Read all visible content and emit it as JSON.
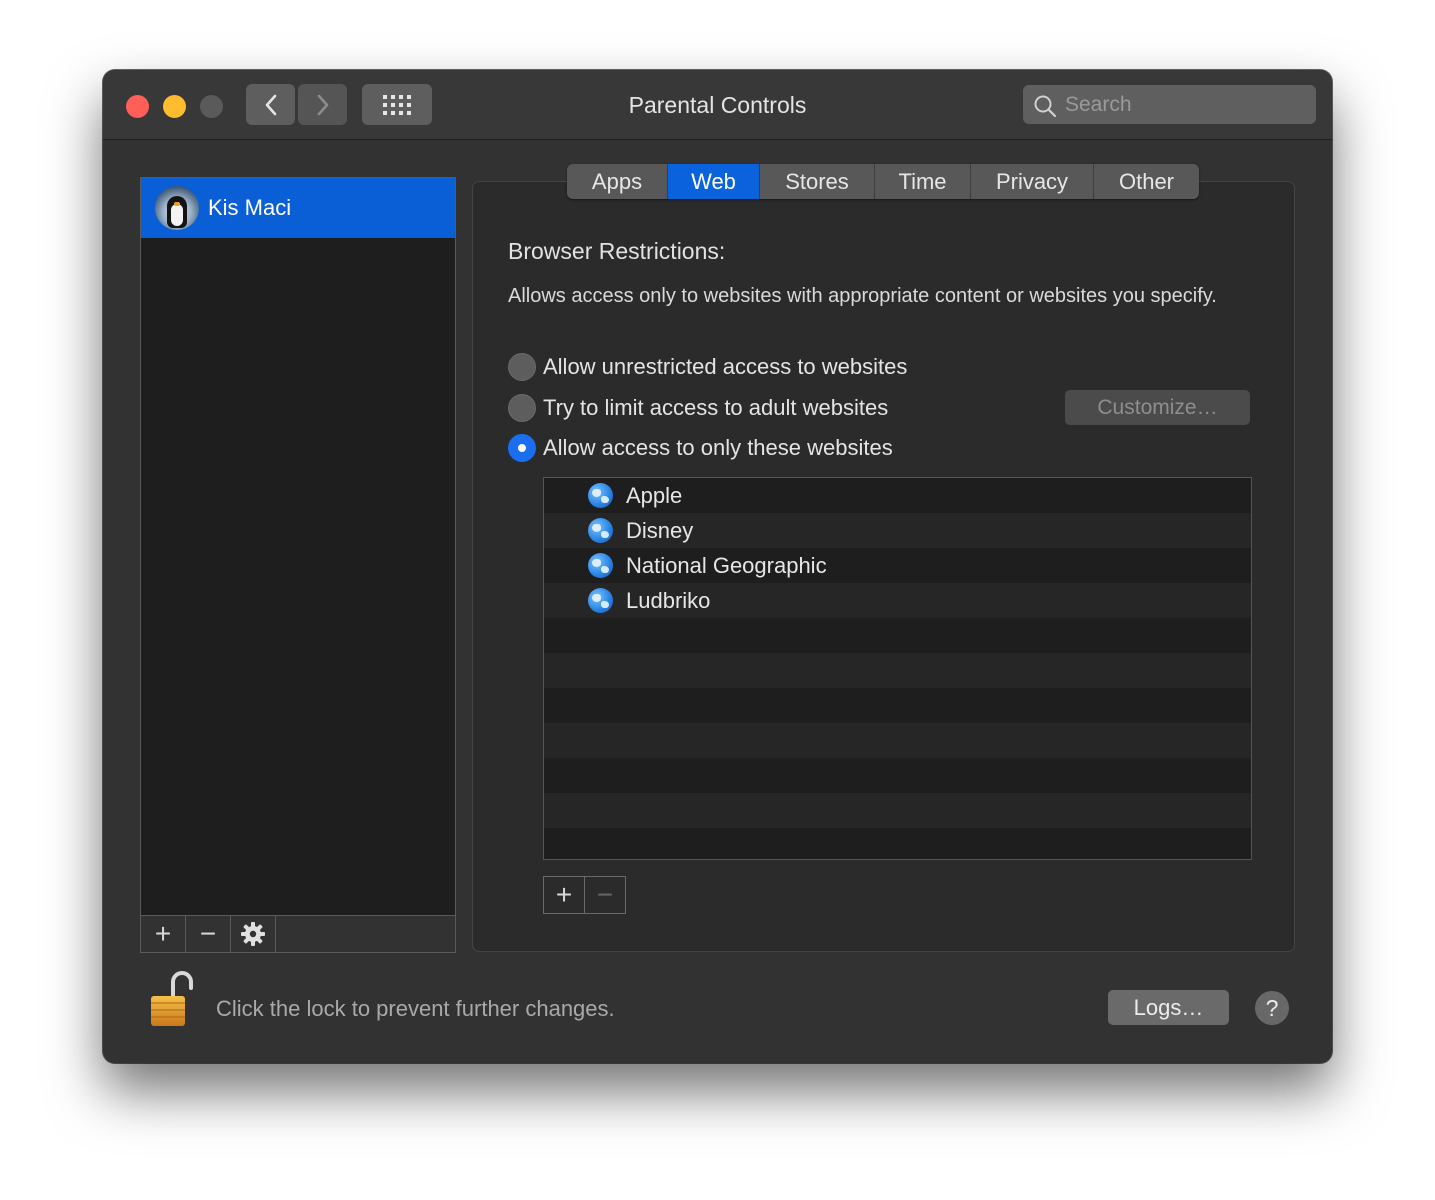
{
  "window": {
    "title": "Parental Controls",
    "search_placeholder": "Search"
  },
  "users": [
    {
      "name": "Kis Maci",
      "selected": true
    }
  ],
  "user_toolbar": {
    "add": "+",
    "remove": "−",
    "settings_icon": "gear-icon"
  },
  "tabs": [
    {
      "label": "Apps",
      "active": false
    },
    {
      "label": "Web",
      "active": true
    },
    {
      "label": "Stores",
      "active": false
    },
    {
      "label": "Time",
      "active": false
    },
    {
      "label": "Privacy",
      "active": false
    },
    {
      "label": "Other",
      "active": false
    }
  ],
  "web": {
    "section_title": "Browser Restrictions:",
    "description": "Allows access only to websites with appropriate content or websites you specify.",
    "options": [
      {
        "label": "Allow unrestricted access to websites",
        "checked": false
      },
      {
        "label": "Try to limit access to adult websites",
        "checked": false
      },
      {
        "label": "Allow access to only these websites",
        "checked": true
      }
    ],
    "customize_label": "Customize…",
    "sites": [
      {
        "label": "Apple"
      },
      {
        "label": "Disney"
      },
      {
        "label": "National Geographic"
      },
      {
        "label": "Ludbriko"
      }
    ],
    "list_add": "+",
    "list_remove": "−"
  },
  "footer": {
    "lock_text": "Click the lock to prevent further changes.",
    "logs_label": "Logs…",
    "help_label": "?"
  },
  "colors": {
    "accent": "#0a62dc",
    "window_bg": "#323232"
  }
}
